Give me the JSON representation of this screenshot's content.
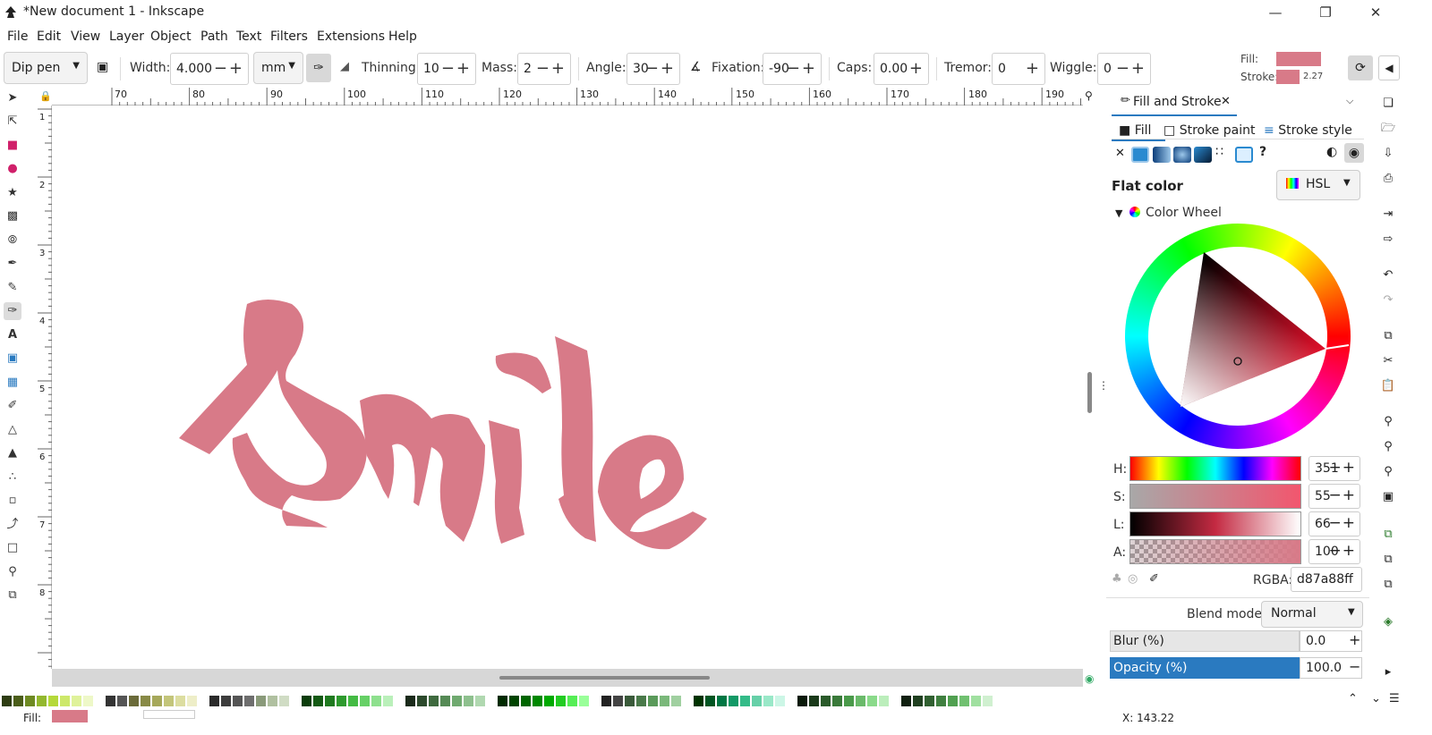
{
  "window": {
    "title": "*New document 1 - Inkscape"
  },
  "menu": [
    "File",
    "Edit",
    "View",
    "Layer",
    "Object",
    "Path",
    "Text",
    "Filters",
    "Extensions",
    "Help"
  ],
  "tool_controls": {
    "preset": "Dip pen",
    "width_label": "Width:",
    "width_value": "4.000",
    "unit": "mm",
    "thinning_label": "Thinning:",
    "thinning_value": "10",
    "mass_label": "Mass:",
    "mass_value": "2",
    "angle_label": "Angle:",
    "angle_value": "30",
    "fixation_label": "Fixation:",
    "fixation_value": "-90",
    "caps_label": "Caps:",
    "caps_value": "0.00",
    "tremor_label": "Tremor:",
    "tremor_value": "0",
    "wiggle_label": "Wiggle:",
    "wiggle_value": "0"
  },
  "style_indicator": {
    "fill_label": "Fill:",
    "stroke_label": "Stroke:",
    "stroke_width": "2.27",
    "fill_color": "#d87a88"
  },
  "ruler_top": [
    "70",
    "80",
    "90",
    "100",
    "110",
    "120",
    "130",
    "140",
    "150",
    "160",
    "170",
    "180",
    "190"
  ],
  "ruler_left": [
    "1",
    "2",
    "3",
    "4",
    "5",
    "6",
    "7",
    "8"
  ],
  "canvas": {
    "drawing_text": "Smile",
    "drawing_color": "#d87a88"
  },
  "panel": {
    "tab_title": "Fill and Stroke",
    "subtabs": [
      "Fill",
      "Stroke paint",
      "Stroke style"
    ],
    "paint_type": "Flat color",
    "color_model": "HSL",
    "wheel_label": "Color Wheel",
    "h_label": "H:",
    "h_value": "351",
    "s_label": "S:",
    "s_value": "55",
    "l_label": "L:",
    "l_value": "66",
    "a_label": "A:",
    "a_value": "100",
    "rgba_label": "RGBA:",
    "rgba_value": "d87a88ff",
    "blend_label": "Blend mode:",
    "blend_value": "Normal",
    "blur_label": "Blur (%)",
    "blur_value": "0.0",
    "opacity_label": "Opacity (%)",
    "opacity_value": "100.0",
    "accent": "#2a7ac0"
  },
  "status": {
    "fill_label": "Fill:",
    "coords": "X:   143.22"
  }
}
